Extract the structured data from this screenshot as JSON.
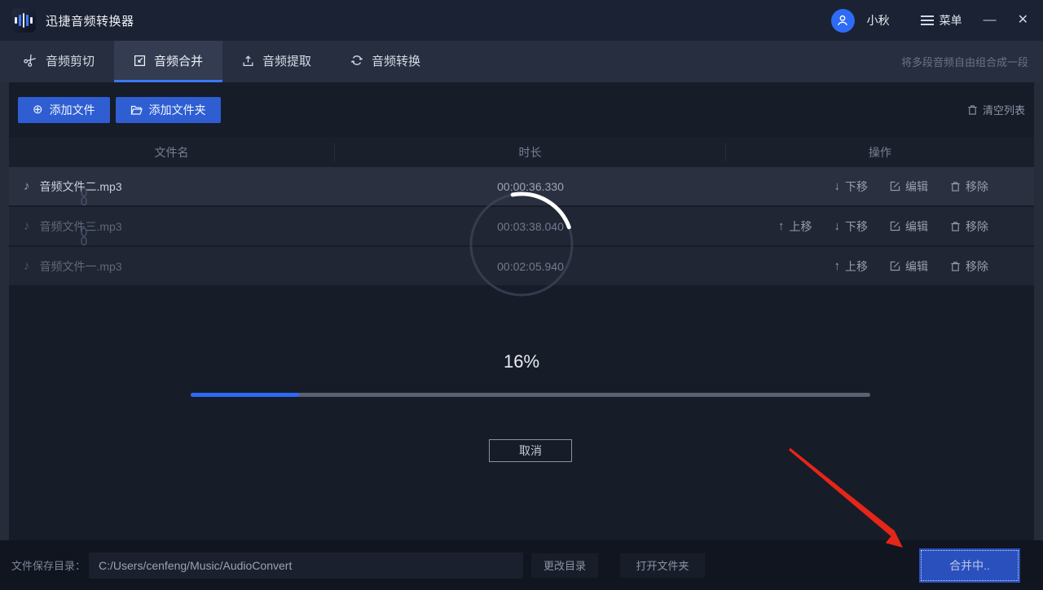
{
  "window": {
    "title": "迅捷音频转换器",
    "user_name": "小秋",
    "menu_label": "菜单",
    "minimize_glyph": "—",
    "close_glyph": "✕"
  },
  "tabs": [
    {
      "label": "音频剪切",
      "icon": "scissors-icon",
      "active": false
    },
    {
      "label": "音频合并",
      "icon": "merge-icon",
      "active": true
    },
    {
      "label": "音频提取",
      "icon": "extract-icon",
      "active": false
    },
    {
      "label": "音频转换",
      "icon": "convert-icon",
      "active": false
    }
  ],
  "tab_subtitle": "将多段音频自由组合成一段",
  "toolbar": {
    "add_file": "添加文件",
    "add_folder": "添加文件夹",
    "clear_list": "清空列表"
  },
  "table": {
    "headers": [
      "文件名",
      "时长",
      "操作"
    ],
    "rows": [
      {
        "name": "音频文件二.mp3",
        "duration": "00:00:36.330",
        "highlight": true,
        "ops": [
          {
            "icon": "arrow-down-icon",
            "label": "下移"
          },
          {
            "icon": "edit-icon",
            "label": "编辑"
          },
          {
            "icon": "trash-icon",
            "label": "移除"
          }
        ]
      },
      {
        "name": "音频文件三.mp3",
        "duration": "00:03:38.040",
        "highlight": false,
        "ops": [
          {
            "icon": "arrow-up-icon",
            "label": "上移"
          },
          {
            "icon": "arrow-down-icon",
            "label": "下移"
          },
          {
            "icon": "edit-icon",
            "label": "编辑"
          },
          {
            "icon": "trash-icon",
            "label": "移除"
          }
        ]
      },
      {
        "name": "音频文件一.mp3",
        "duration": "00:02:05.940",
        "highlight": false,
        "ops": [
          {
            "icon": "arrow-up-icon",
            "label": "上移"
          },
          {
            "icon": "edit-icon",
            "label": "编辑"
          },
          {
            "icon": "trash-icon",
            "label": "移除"
          }
        ]
      }
    ]
  },
  "progress": {
    "percent_label": "16%",
    "value": 16,
    "cancel_label": "取消"
  },
  "footer": {
    "save_dir_label": "文件保存目录：",
    "save_path": "C:/Users/cenfeng/Music/AudioConvert",
    "change_dir": "更改目录",
    "open_folder": "打开文件夹",
    "merge_button": "合并中.."
  },
  "icons": {
    "app-logo-icon": "equalizer-bars",
    "avatar-icon": "person",
    "menu-icon": "hamburger",
    "scissors-icon": "scissors",
    "merge-icon": "square-inward-arrow",
    "extract-icon": "tray-arrow-up",
    "convert-icon": "circular-arrows",
    "plus-circle-icon": "⊕",
    "folder-icon": "folder",
    "trash-icon": "trash-can",
    "arrow-up-icon": "↑",
    "arrow-down-icon": "↓",
    "edit-icon": "square-pencil",
    "music-note-icon": "♪",
    "chain-link-icon": "vertical-chain",
    "annotation-arrow": "red-arrow"
  },
  "colors": {
    "accent_blue": "#2e5ed2",
    "progress_blue": "#2e6bf5",
    "titlebar": "#1b2233",
    "tabbar": "#272e3f",
    "panel": "#171c29",
    "row_highlight": "#2a303f",
    "arrow_red": "#e52619"
  }
}
